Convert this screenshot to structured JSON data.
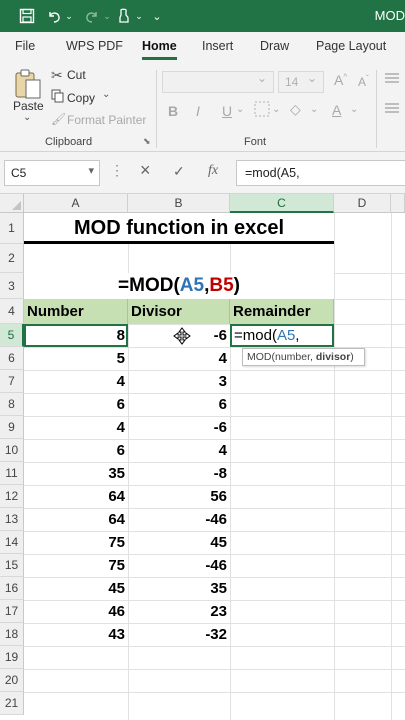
{
  "titlebar": {
    "title": "MOD",
    "qat_icons": [
      "save-icon",
      "undo-icon",
      "undo-dropdown-icon",
      "redo-icon",
      "redo-dropdown-icon",
      "format-painter-icon",
      "customize-qat-icon"
    ]
  },
  "tabs": [
    "File",
    "WPS PDF",
    "Home",
    "Insert",
    "Draw",
    "Page Layout"
  ],
  "ribbon": {
    "paste_label": "Paste",
    "cut_label": "Cut",
    "copy_label": "Copy",
    "format_painter_label": "Format Painter",
    "clipboard_group": "Clipboard",
    "font_group": "Font",
    "font_size": "14",
    "bold": "B",
    "italic": "I",
    "underline": "U"
  },
  "formula_bar": {
    "name_box": "C5",
    "cancel_icon": "×",
    "enter_icon": "✓",
    "fx_icon": "fx",
    "formula": "=mod(A5,"
  },
  "columns": [
    "A",
    "B",
    "C",
    "D"
  ],
  "rows": [
    "1",
    "2",
    "3",
    "4",
    "5",
    "6",
    "7",
    "8",
    "9",
    "10",
    "11",
    "12",
    "13",
    "14",
    "15",
    "16",
    "17",
    "18",
    "19",
    "20",
    "21"
  ],
  "sheet": {
    "title": "MOD function in excel",
    "formula_display": {
      "prefix": "=MOD(",
      "ref_a": "A5",
      "comma": ",",
      "ref_b": "B5",
      "suffix": ")"
    },
    "headers": {
      "number": "Number",
      "divisor": "Divisor",
      "remainder": "Remainder"
    },
    "data": [
      {
        "number": "8",
        "divisor": "-6"
      },
      {
        "number": "5",
        "divisor": "4"
      },
      {
        "number": "4",
        "divisor": "3"
      },
      {
        "number": "6",
        "divisor": "6"
      },
      {
        "number": "4",
        "divisor": "-6"
      },
      {
        "number": "6",
        "divisor": "4"
      },
      {
        "number": "35",
        "divisor": "-8"
      },
      {
        "number": "64",
        "divisor": "56"
      },
      {
        "number": "64",
        "divisor": "-46"
      },
      {
        "number": "75",
        "divisor": "45"
      },
      {
        "number": "75",
        "divisor": "-46"
      },
      {
        "number": "45",
        "divisor": "35"
      },
      {
        "number": "46",
        "divisor": "23"
      },
      {
        "number": "43",
        "divisor": "-32"
      }
    ],
    "editing": {
      "prefix": "=mod(",
      "ref": "A5",
      "suffix": ","
    },
    "tooltip": {
      "text": "MOD(number, ",
      "bold": "divisor",
      "end": ")"
    }
  },
  "colors": {
    "excel_green": "#217346",
    "header_fill": "#c6e0b4",
    "ref_blue": "#2f75b5",
    "ref_red": "#c00000"
  }
}
